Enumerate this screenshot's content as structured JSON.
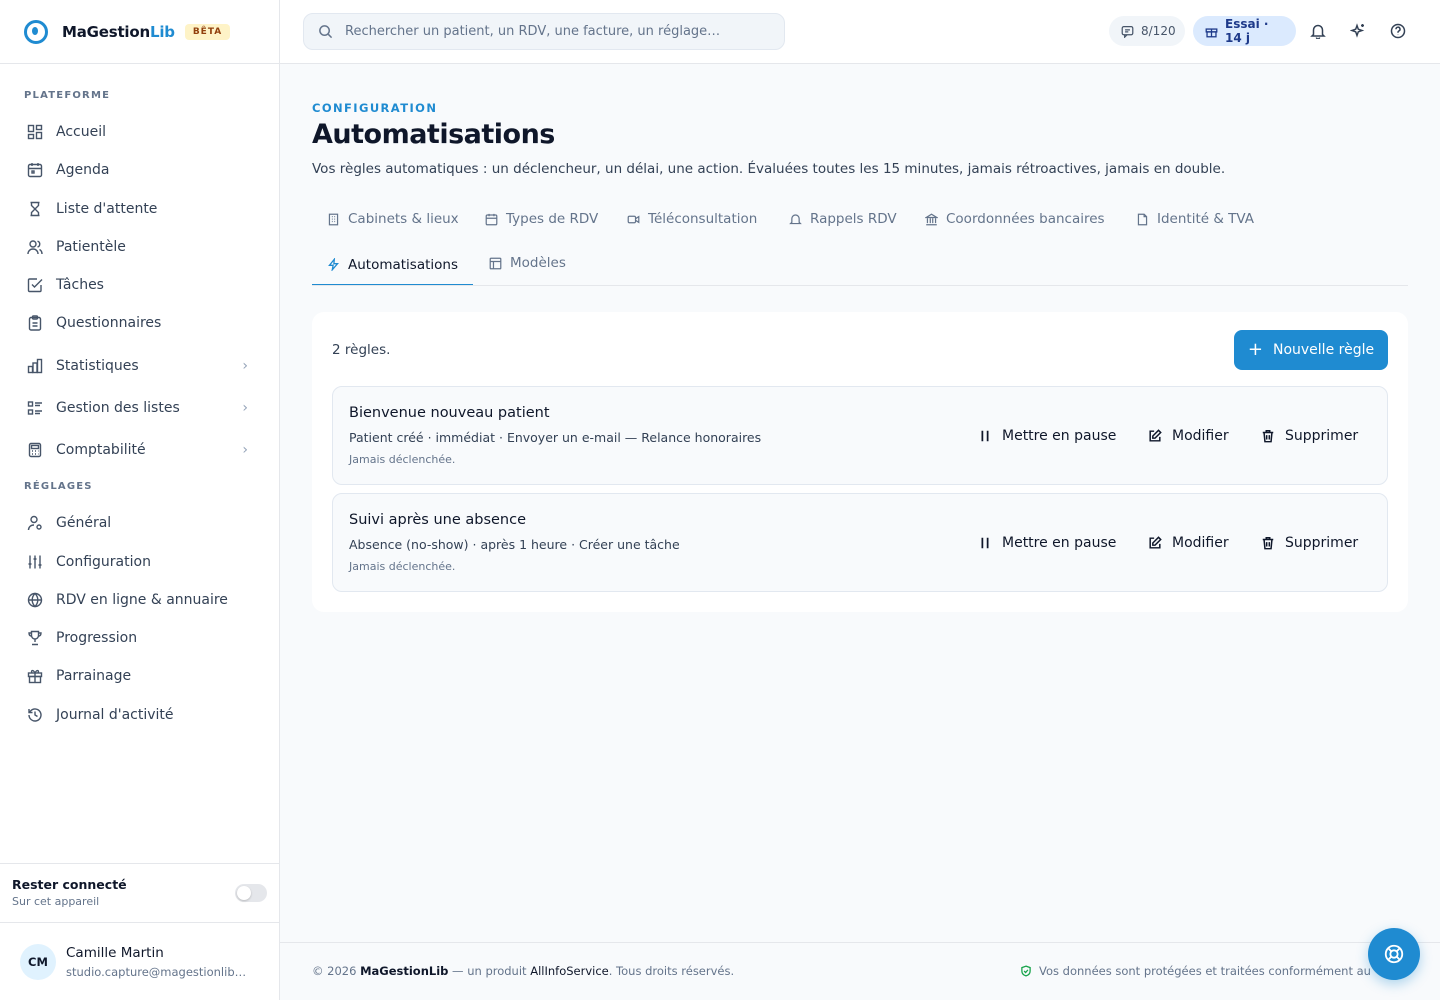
{
  "brand": {
    "name_part1": "MaGestion",
    "name_part2": "Lib",
    "badge": "BÊTA"
  },
  "sidebar": {
    "platform_label": "PLATEFORME",
    "platform_items": [
      {
        "label": "Accueil",
        "icon": "dashboard-icon"
      },
      {
        "label": "Agenda",
        "icon": "calendar-icon"
      },
      {
        "label": "Liste d'attente",
        "icon": "hourglass-icon"
      },
      {
        "label": "Patientèle",
        "icon": "users-icon"
      },
      {
        "label": "Tâches",
        "icon": "checkbox-icon"
      },
      {
        "label": "Questionnaires",
        "icon": "clipboard-icon"
      },
      {
        "label": "Statistiques",
        "icon": "bar-chart-icon",
        "expandable": true
      },
      {
        "label": "Gestion des listes",
        "icon": "list-icon",
        "expandable": true
      },
      {
        "label": "Comptabilité",
        "icon": "calculator-icon",
        "expandable": true
      }
    ],
    "settings_label": "RÉGLAGES",
    "settings_items": [
      {
        "label": "Général",
        "icon": "user-settings-icon"
      },
      {
        "label": "Configuration",
        "icon": "sliders-icon"
      },
      {
        "label": "RDV en ligne & annuaire",
        "icon": "globe-icon"
      },
      {
        "label": "Progression",
        "icon": "trophy-icon"
      },
      {
        "label": "Parrainage",
        "icon": "gift-icon"
      },
      {
        "label": "Journal d'activité",
        "icon": "history-icon"
      }
    ],
    "stay_connected": {
      "title": "Rester connecté",
      "subtitle": "Sur cet appareil",
      "enabled": false
    },
    "user": {
      "initials": "CM",
      "name": "Camille Martin",
      "email": "studio.capture@magestionlib…"
    }
  },
  "topbar": {
    "search_placeholder": "Rechercher un patient, un RDV, une facture, un réglage…",
    "quota": "8/120",
    "trial": "Essai · 14 j"
  },
  "main": {
    "eyebrow": "CONFIGURATION",
    "title": "Automatisations",
    "description": "Vos règles automatiques : un déclencheur, un délai, une action. Évaluées toutes les 15 minutes, jamais rétroactives, jamais en double.",
    "tabs": [
      {
        "label": "Cabinets & lieux",
        "icon": "building-icon"
      },
      {
        "label": "Types de RDV",
        "icon": "calendar-icon"
      },
      {
        "label": "Téléconsultation",
        "icon": "video-icon"
      },
      {
        "label": "Rappels RDV",
        "icon": "bell-icon"
      },
      {
        "label": "Coordonnées bancaires",
        "icon": "bank-icon"
      },
      {
        "label": "Identité & TVA",
        "icon": "document-icon"
      },
      {
        "label": "Automatisations",
        "icon": "lightning-icon",
        "active": true
      },
      {
        "label": "Modèles",
        "icon": "template-icon"
      }
    ],
    "rule_count": "2 règles.",
    "new_rule_label": "Nouvelle règle",
    "rules": [
      {
        "title": "Bienvenue nouveau patient",
        "meta": "Patient créé · immédiat · Envoyer un e-mail — Relance honoraires",
        "status": "Jamais déclenchée."
      },
      {
        "title": "Suivi après une absence",
        "meta": "Absence (no-show) · après 1 heure · Créer une tâche",
        "status": "Jamais déclenchée."
      }
    ],
    "actions": {
      "pause": "Mettre en pause",
      "edit": "Modifier",
      "delete": "Supprimer"
    }
  },
  "footer": {
    "copyright": "© 2026 ",
    "brand": "MaGestionLib",
    "sep": " — un produit ",
    "company": "AllInfoService",
    "rights": ". Tous droits réservés.",
    "privacy": "Vos données sont protégées et traitées conformément au"
  },
  "colors": {
    "accent": "#1f8bd1",
    "beta_bg": "#fef3c7",
    "trial_bg": "#dbeafe"
  }
}
